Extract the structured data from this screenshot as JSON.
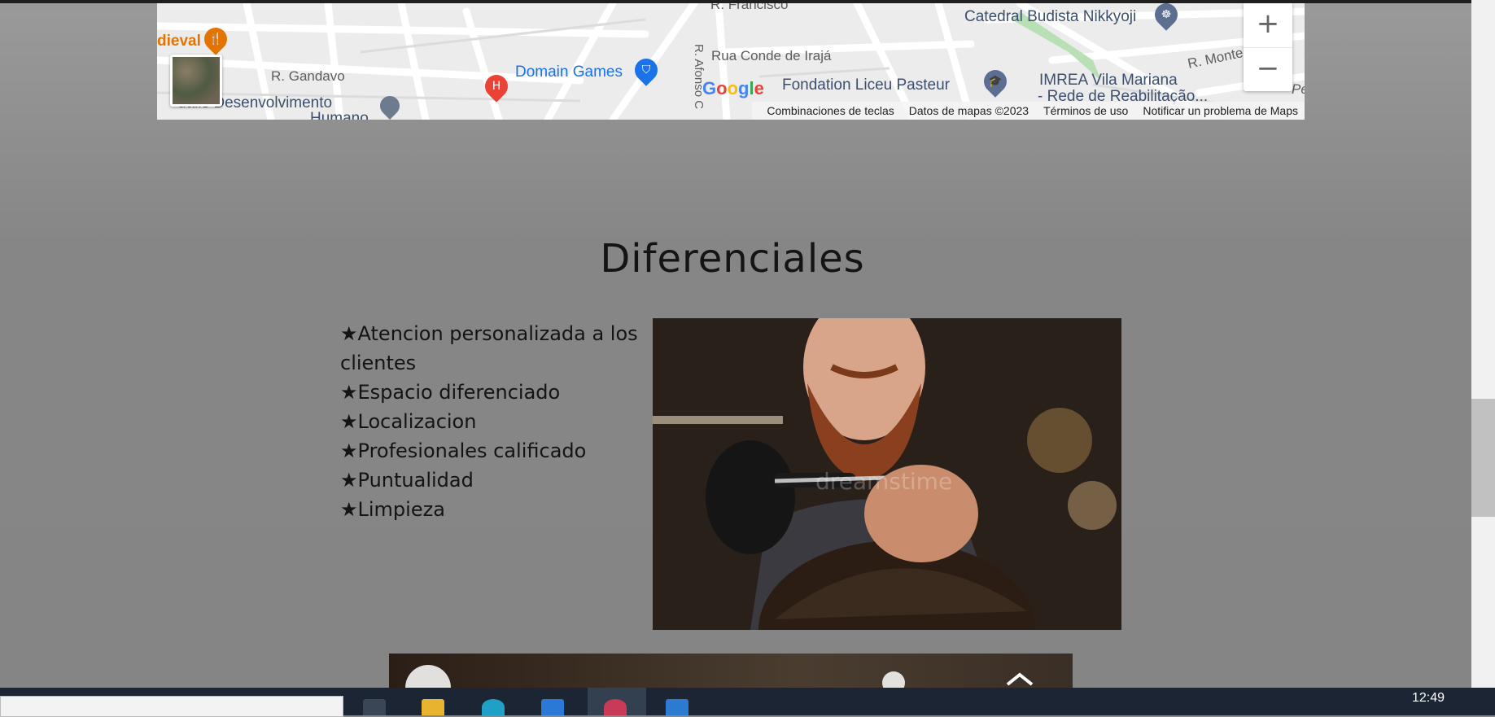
{
  "map": {
    "labels": {
      "street_top": "R. Francisco",
      "medieval": "dieval",
      "gandavo": "R. Gandavo",
      "desenvolvimento": "dalis Desenvolvimento",
      "humano": "Humano",
      "domain_games": "Domain Games",
      "conde": "Rua Conde de Irajá",
      "afonso": "R. Afonso C",
      "fondation": "Fondation Liceu Pasteur",
      "catedral": "Catedral Budista Nikkyoji",
      "imrea1": "IMREA Vila Mariana",
      "imrea2": "- Rede de Reabilitação...",
      "monte": "R. Monte",
      "pe": "Pe"
    },
    "google_logo": "Google",
    "attribution": [
      "Combinaciones de teclas",
      "Datos de mapas ©2023",
      "Términos de uso",
      "Notificar un problema de Maps"
    ],
    "zoom_in": "+",
    "zoom_out": "−",
    "icons": [
      "restaurant-icon",
      "shopping-icon",
      "hospital-icon",
      "school-icon",
      "temple-icon",
      "place-icon"
    ]
  },
  "section": {
    "title": "Diferenciales",
    "items": [
      "★Atencion personalizada a los clientes",
      "★Espacio diferenciado",
      "★Localizacion",
      "★Profesionales calificado",
      "★Puntualidad",
      "★Limpieza"
    ],
    "photo_watermark": "dreamstime"
  },
  "taskbar": {
    "time": "12:49"
  },
  "colors": {
    "background": "#878787",
    "map_blue": "#1a73e8",
    "map_orange": "#e37400",
    "taskbar": "#1c2533"
  }
}
